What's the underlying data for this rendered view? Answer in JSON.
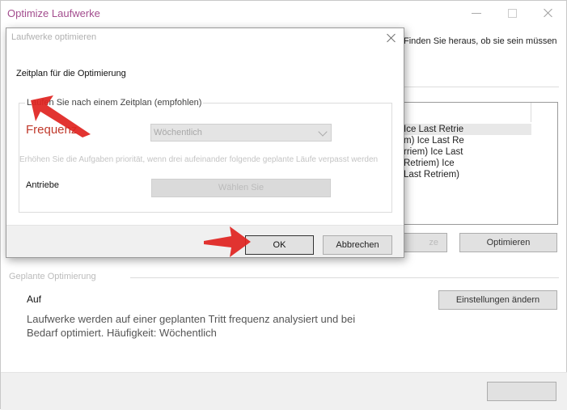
{
  "background_window": {
    "title": "Optimize Laufwerke",
    "intro_text": "Finden Sie heraus, ob sie sein müssen",
    "drive_rows": [
      "Ice Last Retrie",
      "m) Ice Last Re",
      "rriem) Ice Last",
      "Retriem) Ice",
      "Last Retriem)"
    ],
    "analyze_button_label": "ze",
    "optimize_button_label": "Optimieren",
    "scheduled_legend": "Geplante Optimierung",
    "on_label": "Auf",
    "change_settings_label": "Einstellungen ändern",
    "description": "Laufwerke werden auf einer geplanten Tritt frequenz analysiert und bei Bedarf optimiert. Häufigkeit: Wöchentlich",
    "close_button_label": ""
  },
  "dialog": {
    "title": "Laufwerke optimieren",
    "heading": "Zeitplan für die Optimierung",
    "schedule_checkbox_label": "Laufen Sie nach einem Zeitplan (empfohlen)",
    "frequency_label": "Frequenz",
    "frequency_value": "Wöchentlich",
    "priority_text": "Erhöhen Sie die Aufgaben priorität, wenn drei aufeinander folgende geplante Läufe verpasst werden",
    "drives_label": "Antriebe",
    "choose_button_label": "Wählen Sie",
    "ok_label": "OK",
    "cancel_label": "Abbrechen"
  },
  "colors": {
    "title_accent": "#a34d8e",
    "frequency_label": "#c0392b",
    "arrow_red": "#e0231f"
  }
}
